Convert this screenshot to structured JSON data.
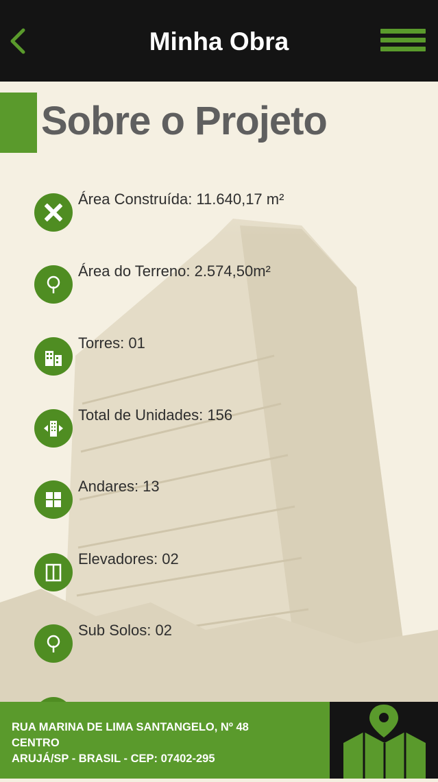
{
  "header": {
    "title": "Minha Obra"
  },
  "page": {
    "heading": "Sobre o Projeto"
  },
  "specs": [
    {
      "label": "Área Construída: 11.640,17 m²",
      "icon": "ruler-pencil-icon"
    },
    {
      "label": "Área do Terreno: 2.574,50m²",
      "icon": "tree-icon"
    },
    {
      "label": "Torres: 01",
      "icon": "buildings-icon"
    },
    {
      "label": "Total de Unidades: 156",
      "icon": "units-arrows-icon"
    },
    {
      "label": "Andares: 13",
      "icon": "floors-grid-icon"
    },
    {
      "label": "Elevadores: 02",
      "icon": "elevator-icon"
    },
    {
      "label": "Sub Solos: 02",
      "icon": "tree-icon"
    }
  ],
  "footer": {
    "address_line1": "RUA MARINA DE LIMA SANTANGELO, Nº 48",
    "address_line2": "CENTRO",
    "address_line3": "ARUJÁ/SP - BRASIL - CEP: 07402-295"
  },
  "colors": {
    "accent": "#5a9a2c",
    "icon_bg": "#4f8d22",
    "topbar": "#141414"
  }
}
